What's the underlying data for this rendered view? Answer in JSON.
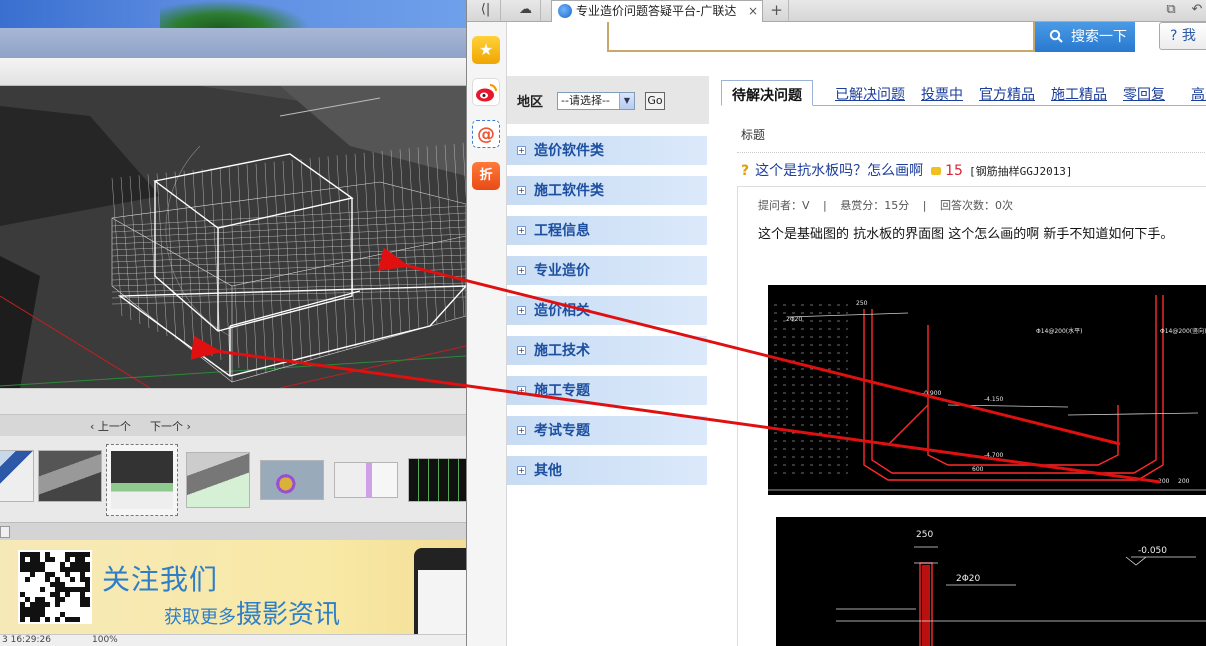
{
  "viewer": {
    "nav_prev": "上一个",
    "nav_next": "下一个",
    "banner_title": "关注我们",
    "banner_sub_small": "获取更多",
    "banner_sub_big": "摄影资讯",
    "footer_time": "3  16:29:26",
    "footer_zoom": "100%"
  },
  "browser": {
    "tab_title": "专业造价问题答疑平台-广联达",
    "tab_close": "×",
    "new_tab": "+",
    "search_button": "搜索一下",
    "help_button": "我",
    "help_icon": "?",
    "side_icons": [
      "star-icon",
      "weibo-icon",
      "mail-icon",
      "discount-icon"
    ],
    "side_icon_discount": "折",
    "side_icon_mail": "@",
    "side_icon_star": "★"
  },
  "leftnav": {
    "region_label": "地区",
    "region_select": "--请选择--",
    "go_label": "Go",
    "categories": [
      "造价软件类",
      "施工软件类",
      "工程信息",
      "专业造价",
      "造价相关",
      "施工技术",
      "施工专题",
      "考试专题",
      "其他"
    ]
  },
  "content": {
    "tabs": [
      "待解决问题",
      "已解决问题",
      "投票中",
      "官方精品",
      "施工精品",
      "零回复",
      "高悬"
    ],
    "title_header": "标题",
    "question_title": "这个是抗水板吗？怎么画啊",
    "question_score": "15",
    "question_tag": "[钢筋抽样GGJ2013]",
    "meta_asker": "提问者：V",
    "meta_sep": "|",
    "meta_reward": "悬赏分：15分",
    "meta_answers": "回答次数：0次",
    "description": "这个是基础图的 抗水板的界面图 这个怎么画的啊 新手不知道如何下手。",
    "cad_labels_1": [
      "250",
      "2Φ20",
      "Φ14@200(水平)",
      "Φ14@200(竖向)",
      "-4.150",
      "-4.700",
      "600",
      "-0.900",
      "200",
      "200"
    ],
    "cad_labels_2": [
      "250",
      "2Φ20",
      "-0.050"
    ]
  },
  "colors": {
    "arrow_red": "#e01010",
    "category_text": "#1c4fa0",
    "link_blue": "#1c3f9c",
    "search_blue": "#2879cf"
  }
}
